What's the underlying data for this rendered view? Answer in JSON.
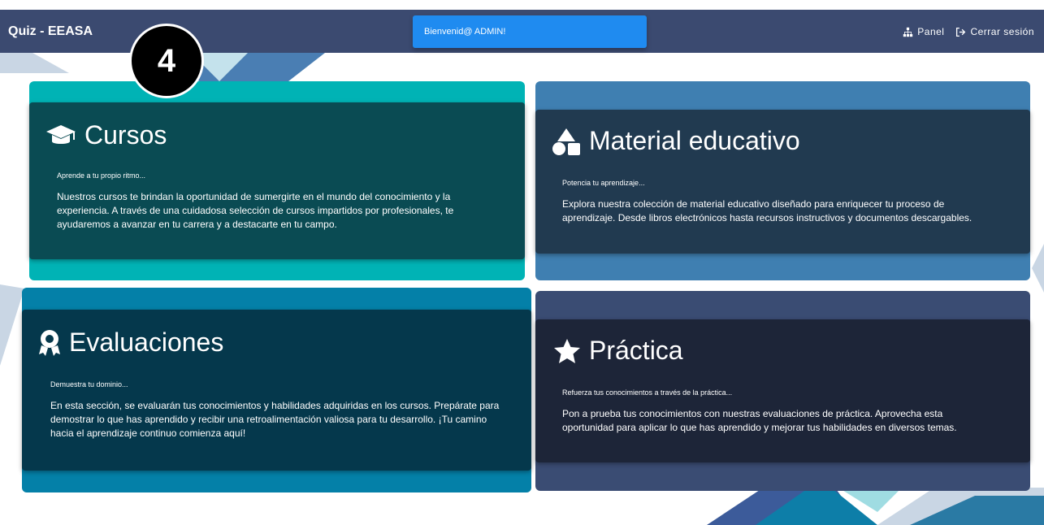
{
  "navbar": {
    "brand": "Quiz - EEASA",
    "panel_label": "Panel",
    "logout_label": "Cerrar sesión"
  },
  "toast": {
    "message": "Bienvenid@ ADMIN!"
  },
  "step_badge": "4",
  "cards": {
    "cursos": {
      "title": "Cursos",
      "subtitle": "Aprende a tu propio ritmo...",
      "text": "Nuestros cursos te brindan la oportunidad de sumergirte en el mundo del conocimiento y la experiencia. A través de una cuidadosa selección de cursos impartidos por profesionales, te ayudaremos a avanzar en tu carrera y a destacarte en tu campo."
    },
    "material": {
      "title": "Material educativo",
      "subtitle": "Potencia tu aprendizaje...",
      "text": "Explora nuestra colección de material educativo diseñado para enriquecer tu proceso de aprendizaje. Desde libros electrónicos hasta recursos instructivos y documentos descargables."
    },
    "evaluaciones": {
      "title": "Evaluaciones",
      "subtitle": "Demuestra tu dominio...",
      "text": "En esta sección, se evaluarán tus conocimientos y habilidades adquiridas en los cursos. Prepárate para demostrar lo que has aprendido y recibir una retroalimentación valiosa para tu desarrollo. ¡Tu camino hacia el aprendizaje continuo comienza aquí!"
    },
    "practica": {
      "title": "Práctica",
      "subtitle": "Refuerza tus conocimientos a través de la práctica...",
      "text": "Pon a prueba tus conocimientos con nuestras evaluaciones de práctica. Aprovecha esta oportunidad para aplicar lo que has aprendido y mejorar tus habilidades en diversos temas."
    }
  },
  "icons": [
    "graduation-cap-icon",
    "shapes-icon",
    "award-icon",
    "star-icon",
    "sitemap-icon",
    "sign-out-icon"
  ],
  "colors": {
    "navbar": "#3b4a70",
    "toast": "#1f8bf0",
    "cursos_outer": "#00b3b5",
    "cursos_inner": "#0a4b53",
    "material_outer": "#3f7fb1",
    "material_inner": "#213a50",
    "evaluaciones_outer": "#0480a8",
    "evaluaciones_inner": "#05384c",
    "practica_outer": "#3a4c73",
    "practica_inner": "#1d2538"
  }
}
